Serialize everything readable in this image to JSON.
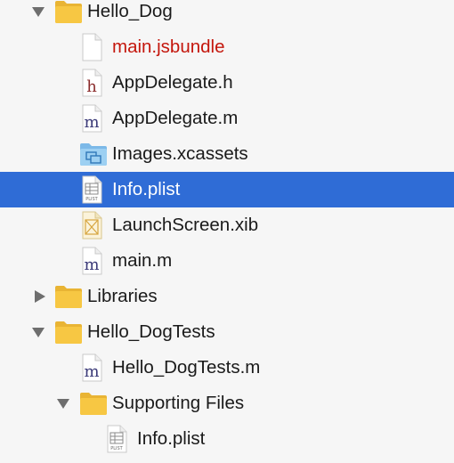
{
  "navigator": {
    "items": [
      {
        "label": "Hello_Dog",
        "kind": "group",
        "expanded": true,
        "icon": "folder-icon"
      },
      {
        "label": "main.jsbundle",
        "kind": "file",
        "icon": "generic-file-icon",
        "color": "#c4160c"
      },
      {
        "label": "AppDelegate.h",
        "kind": "file",
        "icon": "header-file-icon",
        "glyph": "h"
      },
      {
        "label": "AppDelegate.m",
        "kind": "file",
        "icon": "objc-file-icon",
        "glyph": "m"
      },
      {
        "label": "Images.xcassets",
        "kind": "file",
        "icon": "asset-catalog-icon"
      },
      {
        "label": "Info.plist",
        "kind": "file",
        "icon": "plist-file-icon",
        "glyph": "PLIST",
        "selected": true
      },
      {
        "label": "LaunchScreen.xib",
        "kind": "file",
        "icon": "xib-file-icon"
      },
      {
        "label": "main.m",
        "kind": "file",
        "icon": "objc-file-icon",
        "glyph": "m"
      },
      {
        "label": "Libraries",
        "kind": "group",
        "expanded": false,
        "icon": "folder-icon"
      },
      {
        "label": "Hello_DogTests",
        "kind": "group",
        "expanded": true,
        "icon": "folder-icon"
      },
      {
        "label": "Hello_DogTests.m",
        "kind": "file",
        "icon": "objc-file-icon",
        "glyph": "m"
      },
      {
        "label": "Supporting Files",
        "kind": "group",
        "expanded": true,
        "icon": "folder-icon"
      },
      {
        "label": "Info.plist",
        "kind": "file",
        "icon": "plist-file-icon",
        "glyph": "PLIST"
      }
    ],
    "colors": {
      "selection": "#2f6cd6",
      "background": "#f6f6f6",
      "folder": "#f7c743",
      "warning_text": "#c4160c"
    }
  }
}
